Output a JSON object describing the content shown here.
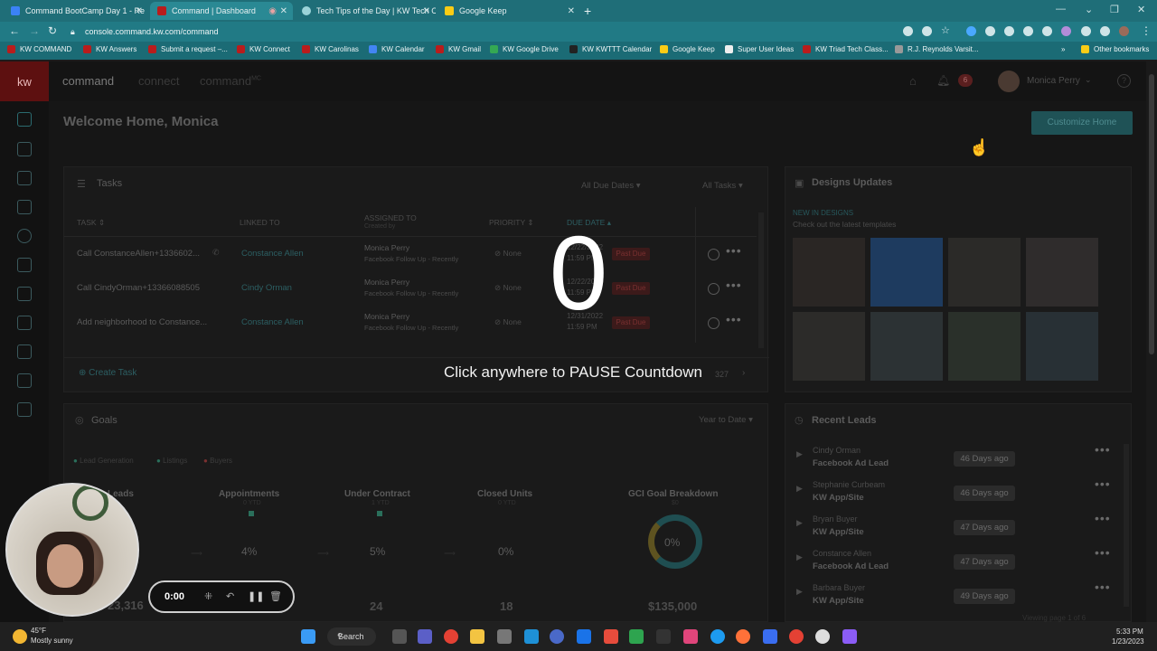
{
  "browser": {
    "tabs": [
      {
        "title": "Command BootCamp Day 1 - Re",
        "active": false
      },
      {
        "title": "Command | Dashboard",
        "active": true
      },
      {
        "title": "Tech Tips of the Day | KW Tech C",
        "active": false
      },
      {
        "title": "Google Keep",
        "active": false
      }
    ],
    "url": "console.command.kw.com/command",
    "bookmarks": [
      "KW COMMAND",
      "KW Answers",
      "Submit a request –...",
      "KW Connect",
      "KW Carolinas",
      "KW Calendar",
      "KW Gmail",
      "KW Google Drive",
      "KW KWTTT Calendar",
      "Google Keep",
      "Super User Ideas",
      "KW Triad Tech Class...",
      "R.J. Reynolds Varsit..."
    ],
    "more_bookmarks": "»",
    "other_bookmarks": "Other bookmarks"
  },
  "app": {
    "logo": "kw",
    "nav": [
      "command",
      "connect",
      "command"
    ],
    "nav_sup": "MC",
    "user_name": "Monica Perry",
    "notif_count": "6",
    "welcome": "Welcome Home, Monica",
    "customize_button": "Customize Home"
  },
  "tasks": {
    "title": "Tasks",
    "filter_due": "All Due Dates",
    "filter_tasks": "All Tasks",
    "columns": [
      "TASK",
      "LINKED TO",
      "ASSIGNED TO",
      "PRIORITY",
      "DUE DATE"
    ],
    "assigned_sub": "Created by",
    "rows": [
      {
        "task": "Call ConstanceAllen+1336602...",
        "linked": "Constance Allen",
        "assigned": "Monica Perry",
        "assigned_sub": "Facebook Follow Up - Recently",
        "priority": "None",
        "date": "12/22/2022",
        "time": "11:59 PM",
        "status": "Past Due"
      },
      {
        "task": "Call CindyOrman+13366088505",
        "linked": "Cindy Orman",
        "assigned": "Monica Perry",
        "assigned_sub": "Facebook Follow Up - Recently",
        "priority": "None",
        "date": "12/22/2022",
        "time": "11:59 PM",
        "status": "Past Due"
      },
      {
        "task": "Add neighborhood to Constance...",
        "linked": "Constance Allen",
        "assigned": "Monica Perry",
        "assigned_sub": "Facebook Follow Up - Recently",
        "priority": "None",
        "date": "12/31/2022",
        "time": "11:59 PM",
        "status": "Past Due"
      }
    ],
    "create_task": "Create Task",
    "pager": "327"
  },
  "designs": {
    "title": "Designs Updates",
    "new_label": "NEW IN DESIGNS",
    "sub": "Check out the latest templates"
  },
  "goals": {
    "title": "Goals",
    "period": "Year to Date",
    "legend": [
      "Lead Generation",
      "Listings",
      "Buyers"
    ],
    "metrics": [
      {
        "label": "Leads",
        "pct": "",
        "value": "23,316"
      },
      {
        "label": "Appointments",
        "sub": "0 YTD",
        "pct": "4%",
        "value": ""
      },
      {
        "label": "Under Contract",
        "sub": "1 YTD",
        "pct": "5%",
        "value": "24"
      },
      {
        "label": "Closed Units",
        "sub": "0 YTD",
        "pct": "0%",
        "value": "18"
      },
      {
        "label": "GCI Goal Breakdown",
        "sub": "$0",
        "pct": "0%",
        "value": "$135,000"
      }
    ]
  },
  "recent_leads": {
    "title": "Recent Leads",
    "leads": [
      {
        "name": "Cindy Orman",
        "source": "Facebook Ad Lead",
        "age": "46 Days ago"
      },
      {
        "name": "Stephanie Curbeam",
        "source": "KW App/Site",
        "age": "46 Days ago"
      },
      {
        "name": "Bryan Buyer",
        "source": "KW App/Site",
        "age": "47 Days ago"
      },
      {
        "name": "Constance Allen",
        "source": "Facebook Ad Lead",
        "age": "47 Days ago"
      },
      {
        "name": "Barbara Buyer",
        "source": "KW App/Site",
        "age": "49 Days ago"
      }
    ],
    "pager": "Viewing page 1 of 6"
  },
  "overlay": {
    "count": "0",
    "message": "Click anywhere to PAUSE Countdown"
  },
  "recorder": {
    "time": "0:00"
  },
  "taskbar": {
    "temp": "45°F",
    "weather": "Mostly sunny",
    "search": "Search",
    "time": "5:33 PM",
    "date": "1/23/2023"
  },
  "colors": {
    "tab_bar": "#1f6e78",
    "accent_teal": "#1f6e73",
    "past_due": "#7a3030"
  }
}
